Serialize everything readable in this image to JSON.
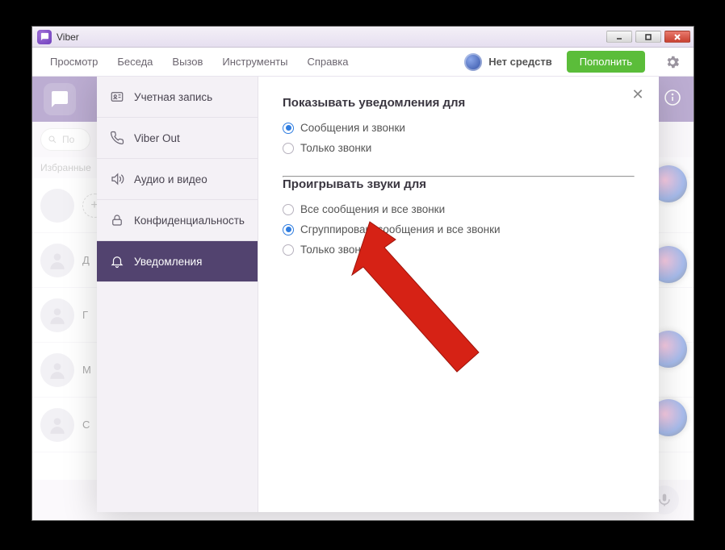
{
  "window": {
    "title": "Viber"
  },
  "menu": {
    "items": [
      "Просмотр",
      "Беседа",
      "Вызов",
      "Инструменты",
      "Справка"
    ],
    "balance_label": "Нет средств",
    "topup_label": "Пополнить"
  },
  "bg": {
    "search_placeholder": "По",
    "favorites_label": "Избранные",
    "contacts": [
      {
        "initial": "Д"
      },
      {
        "initial": "Г"
      },
      {
        "initial": "М"
      },
      {
        "initial": "С"
      }
    ]
  },
  "settings": {
    "sidebar": [
      {
        "key": "account",
        "label": "Учетная запись"
      },
      {
        "key": "viberout",
        "label": "Viber Out"
      },
      {
        "key": "audiovideo",
        "label": "Аудио и видео"
      },
      {
        "key": "privacy",
        "label": "Конфиденциальность"
      },
      {
        "key": "notifications",
        "label": "Уведомления"
      }
    ],
    "active_key": "notifications",
    "sections": {
      "show_notifications": {
        "title": "Показывать уведомления для",
        "options": [
          "Сообщения и звонки",
          "Только звонки"
        ],
        "selected_index": 0
      },
      "play_sounds": {
        "title": "Проигрывать звуки для",
        "options": [
          "Все сообщения и все звонки",
          "Сгруппирован. сообщения и все звонки",
          "Только звонки"
        ],
        "selected_index": 1
      }
    }
  }
}
